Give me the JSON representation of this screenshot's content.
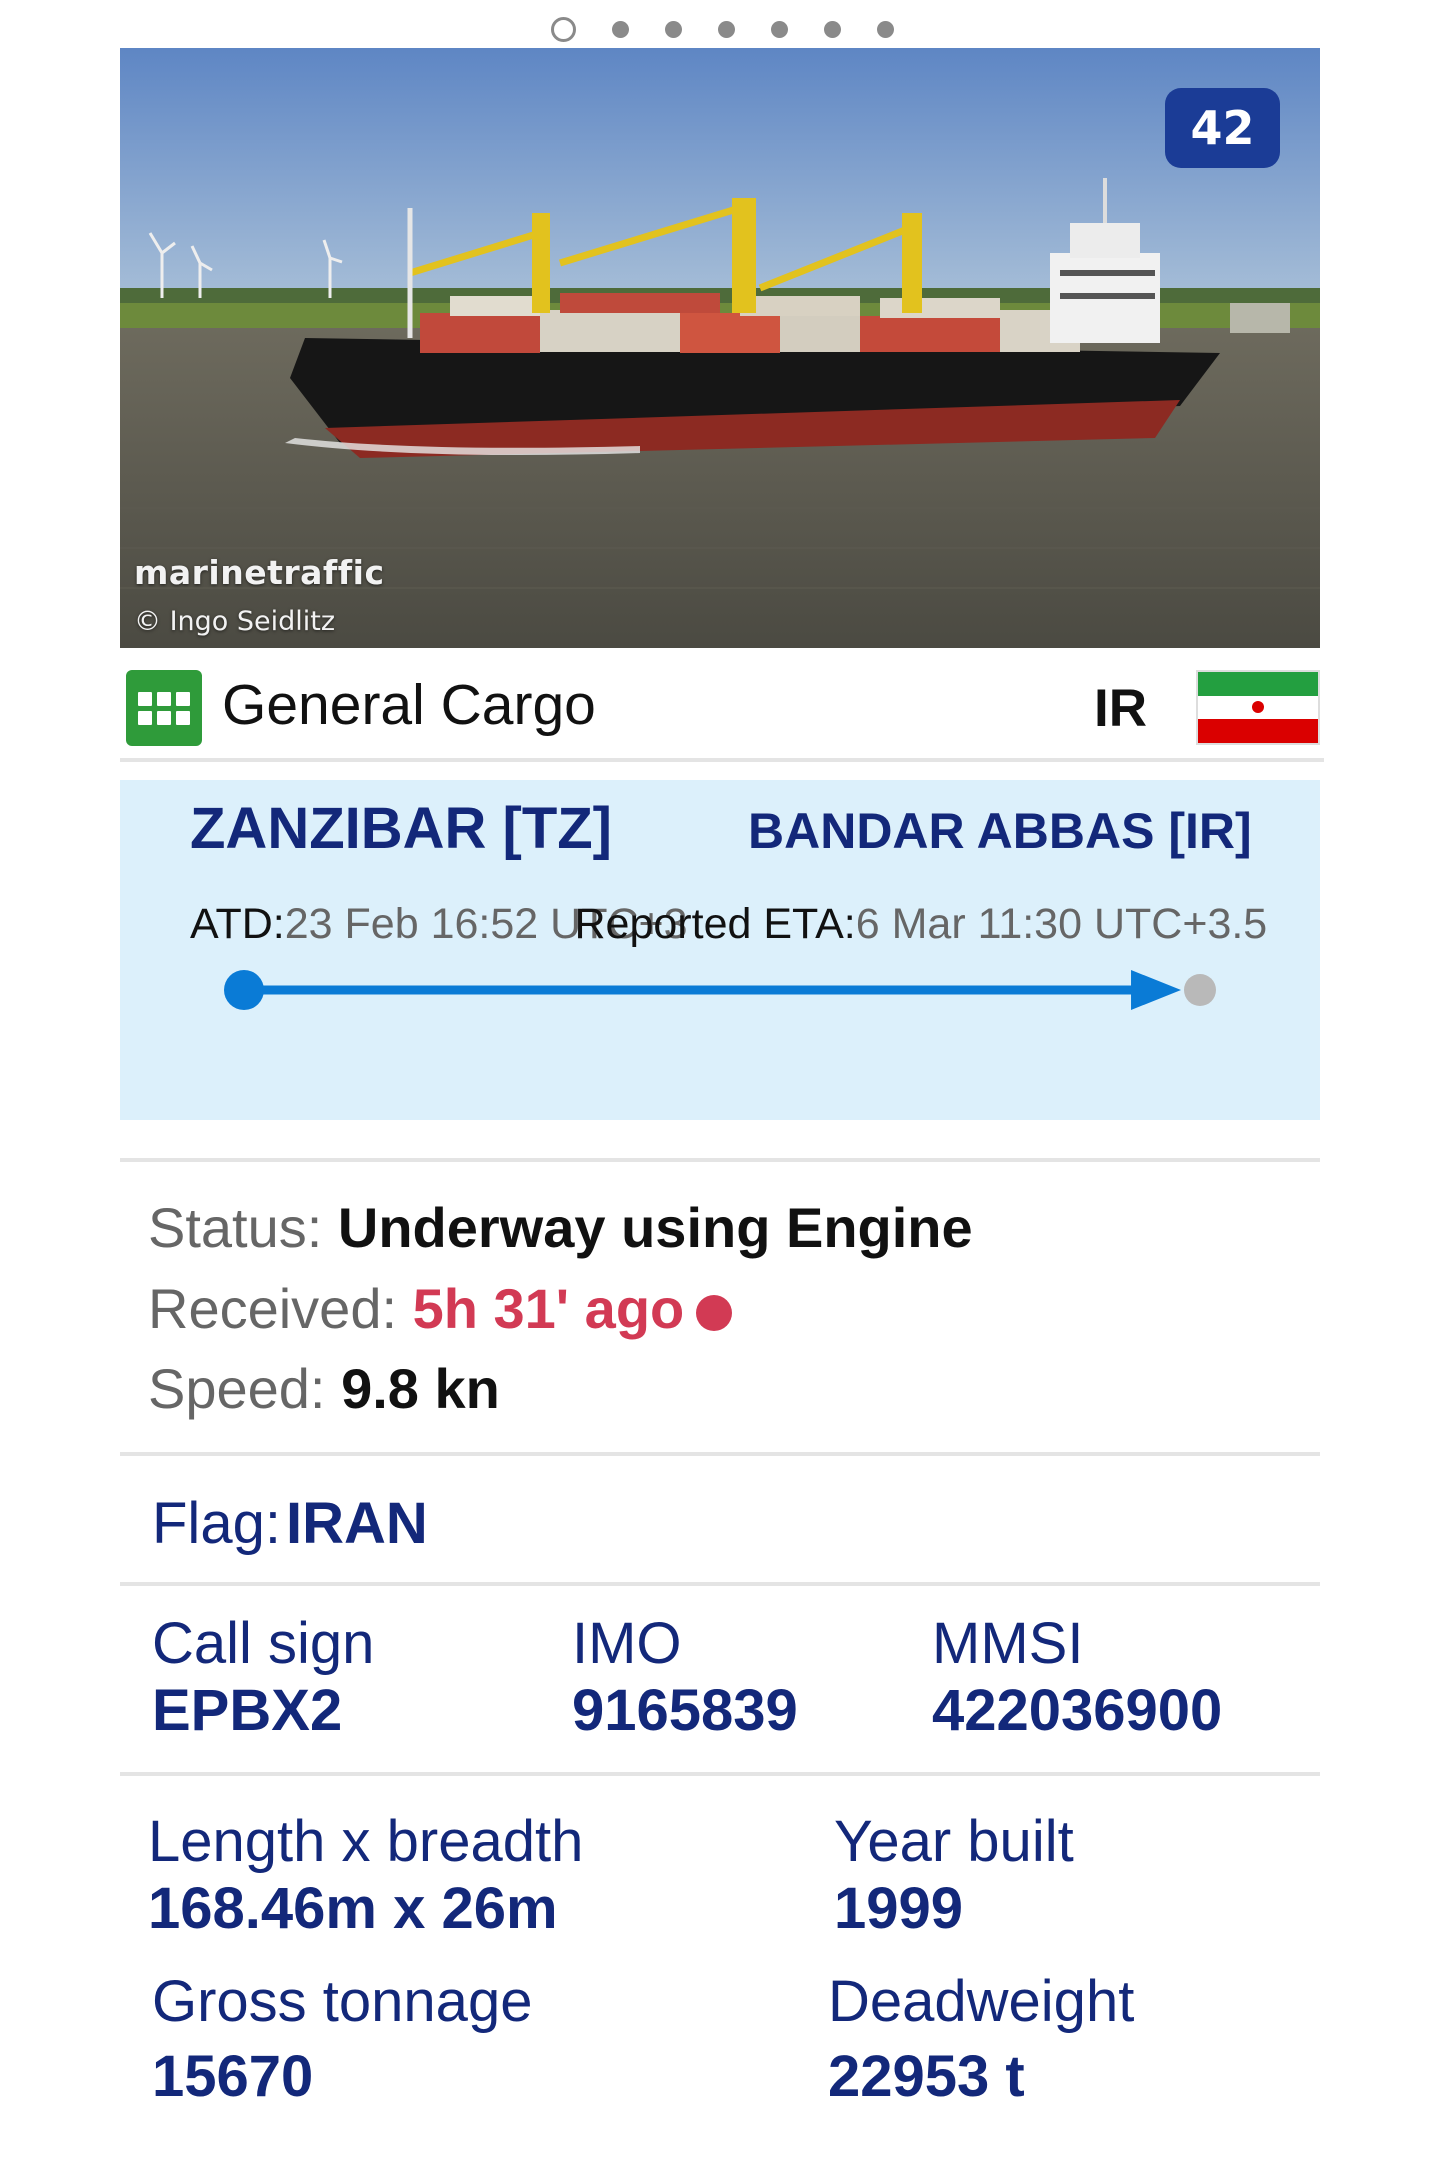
{
  "pager": {
    "count": 7,
    "active": 0
  },
  "photo": {
    "count_badge": "42",
    "watermark": "marinetraffic",
    "credit": "© Ingo Seidlitz"
  },
  "vessel": {
    "type": "General Cargo",
    "country_code": "IR"
  },
  "voyage": {
    "departure_port": "ZANZIBAR [TZ]",
    "arrival_port": "BANDAR ABBAS [IR]",
    "atd_label": "ATD:",
    "atd_value": "23 Feb 16:52 UTC+3",
    "eta_label": "Reported ETA:",
    "eta_value": "6 Mar 11:30 UTC+3.5",
    "progress": 0.97
  },
  "status": {
    "status_label": "Status:",
    "status_value": "Underway using Engine",
    "received_label": "Received:",
    "received_value": "5h 31' ago",
    "speed_label": "Speed:",
    "speed_value": "9.8 kn"
  },
  "flag": {
    "label": "Flag:",
    "value": "IRAN"
  },
  "ids": {
    "callsign_label": "Call sign",
    "callsign_value": "EPBX2",
    "imo_label": "IMO",
    "imo_value": "9165839",
    "mmsi_label": "MMSI",
    "mmsi_value": "422036900"
  },
  "dimensions": {
    "length_label": "Length x breadth",
    "length_value": "168.46m x 26m",
    "year_label": "Year built",
    "year_value": "1999",
    "gross_label": "Gross tonnage",
    "gross_value": "15670",
    "deadweight_label": "Deadweight",
    "deadweight_value": "22953 t"
  },
  "colors": {
    "navy": "#13287a",
    "badge_blue": "#1b3c96",
    "track_blue": "#0a7bd6",
    "alert_red": "#d23a54",
    "type_green": "#2f9b3a",
    "panel_bg": "#dcf0fb"
  }
}
